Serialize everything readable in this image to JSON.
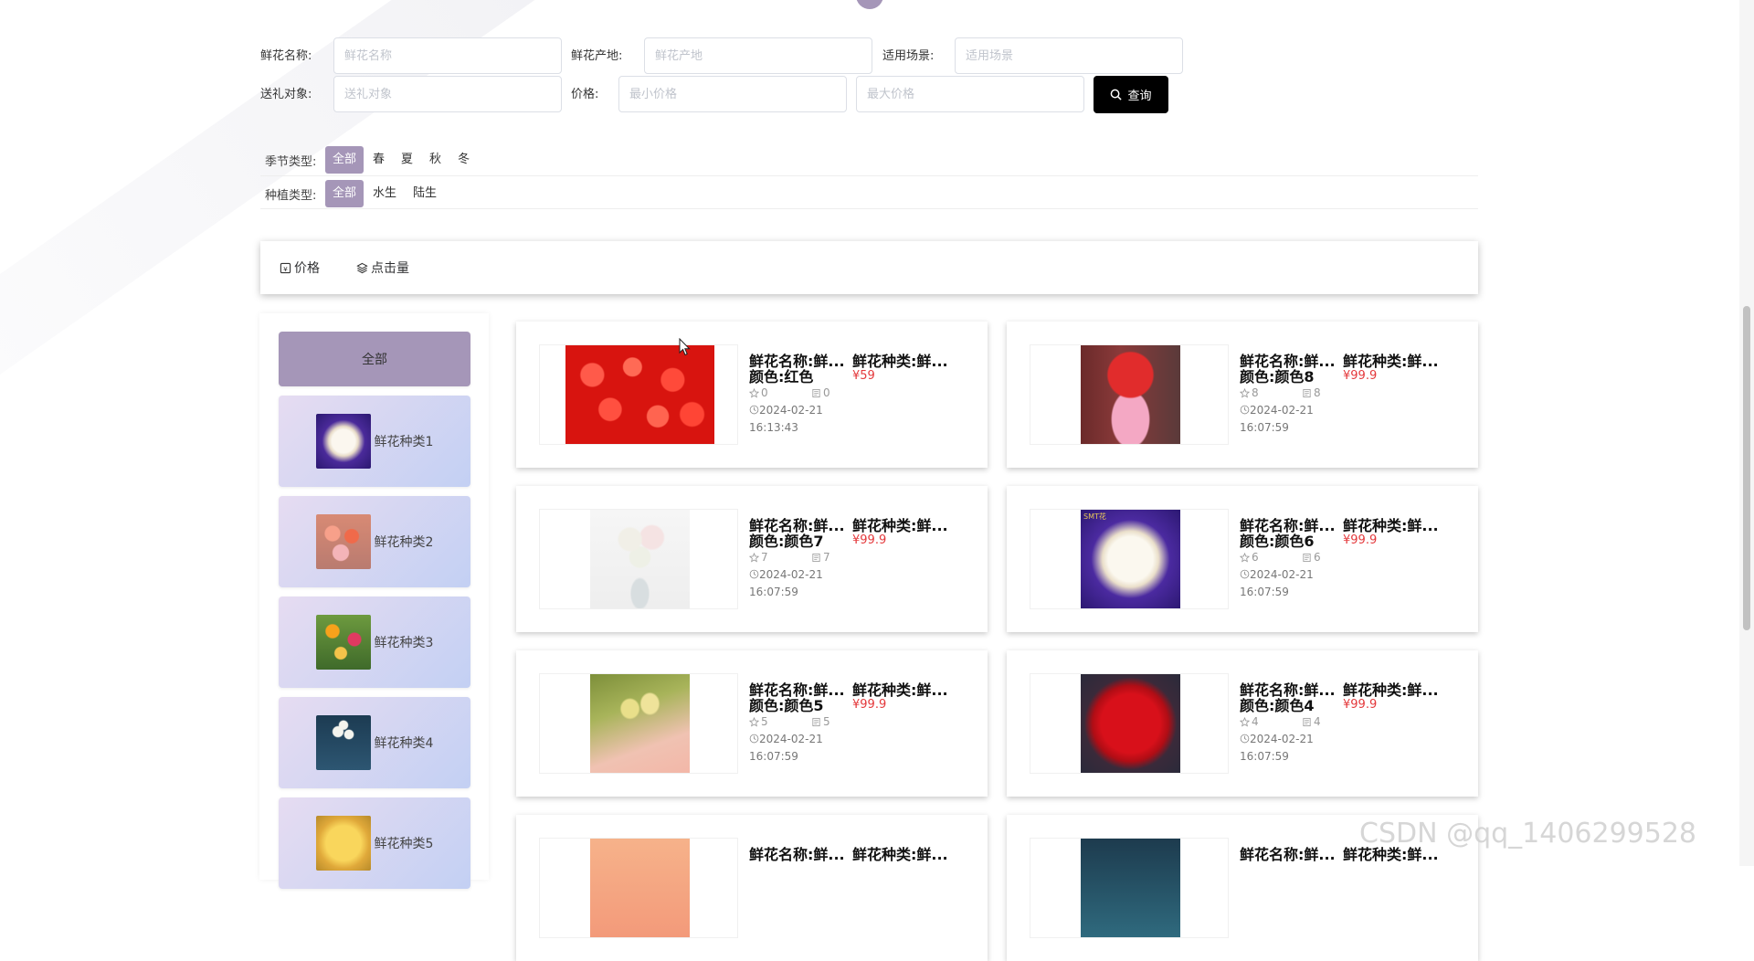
{
  "search": {
    "name_label": "鲜花名称:",
    "name_placeholder": "鲜花名称",
    "origin_label": "鲜花产地:",
    "origin_placeholder": "鲜花产地",
    "scene_label": "适用场景:",
    "scene_placeholder": "适用场景",
    "target_label": "送礼对象:",
    "target_placeholder": "送礼对象",
    "price_label": "价格:",
    "min_price_placeholder": "最小价格",
    "max_price_placeholder": "最大价格",
    "query_button": "查询"
  },
  "filters": {
    "season_label": "季节类型:",
    "season_options": [
      "全部",
      "春",
      "夏",
      "秋",
      "冬"
    ],
    "plant_label": "种植类型:",
    "plant_options": [
      "全部",
      "水生",
      "陆生"
    ]
  },
  "sort": {
    "price": "价格",
    "clicks": "点击量"
  },
  "categories": [
    {
      "label": "全部"
    },
    {
      "label": "鲜花种类1",
      "icon": "white-roses-purple-wrap-thumb"
    },
    {
      "label": "鲜花种类2",
      "icon": "pink-orange-roses-thumb"
    },
    {
      "label": "鲜花种类3",
      "icon": "mixed-lilies-thumb"
    },
    {
      "label": "鲜花种类4",
      "icon": "white-tulips-thumb"
    },
    {
      "label": "鲜花种类5",
      "icon": "yellow-roses-thumb"
    }
  ],
  "products": [
    {
      "name": "鲜花名称:鲜...",
      "type": "鲜花种类:鲜...",
      "color": "颜色:红色",
      "price": "¥59",
      "favorites": "0",
      "comments": "0",
      "date": "2024-02-21",
      "time": "16:13:43"
    },
    {
      "name": "鲜花名称:鲜...",
      "type": "鲜花种类:鲜...",
      "color": "颜色:颜色8",
      "price": "¥99.9",
      "favorites": "8",
      "comments": "8",
      "date": "2024-02-21",
      "time": "16:07:59"
    },
    {
      "name": "鲜花名称:鲜...",
      "type": "鲜花种类:鲜...",
      "color": "颜色:颜色7",
      "price": "¥99.9",
      "favorites": "7",
      "comments": "7",
      "date": "2024-02-21",
      "time": "16:07:59"
    },
    {
      "name": "鲜花名称:鲜...",
      "type": "鲜花种类:鲜...",
      "color": "颜色:颜色6",
      "price": "¥99.9",
      "favorites": "6",
      "comments": "6",
      "date": "2024-02-21",
      "time": "16:07:59"
    },
    {
      "name": "鲜花名称:鲜...",
      "type": "鲜花种类:鲜...",
      "color": "颜色:颜色5",
      "price": "¥99.9",
      "favorites": "5",
      "comments": "5",
      "date": "2024-02-21",
      "time": "16:07:59"
    },
    {
      "name": "鲜花名称:鲜...",
      "type": "鲜花种类:鲜...",
      "color": "颜色:颜色4",
      "price": "¥99.9",
      "favorites": "4",
      "comments": "4",
      "date": "2024-02-21",
      "time": "16:07:59"
    },
    {
      "name": "鲜花名称:鲜...",
      "type": "鲜花种类:鲜..."
    },
    {
      "name": "鲜花名称:鲜...",
      "type": "鲜花种类:鲜..."
    }
  ],
  "photo_badge": "SMT花",
  "watermark": "CSDN @qq_1406299528",
  "colors": {
    "accent": "#a596b8",
    "price": "#e4393c",
    "button": "#000000"
  }
}
